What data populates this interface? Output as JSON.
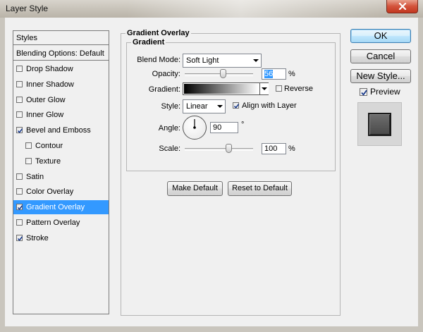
{
  "window": {
    "title": "Layer Style"
  },
  "styles_panel": {
    "header": "Styles",
    "blending_options": "Blending Options: Default",
    "items": [
      {
        "label": "Drop Shadow",
        "checked": false,
        "indent": false,
        "selected": false
      },
      {
        "label": "Inner Shadow",
        "checked": false,
        "indent": false,
        "selected": false
      },
      {
        "label": "Outer Glow",
        "checked": false,
        "indent": false,
        "selected": false
      },
      {
        "label": "Inner Glow",
        "checked": false,
        "indent": false,
        "selected": false
      },
      {
        "label": "Bevel and Emboss",
        "checked": true,
        "indent": false,
        "selected": false
      },
      {
        "label": "Contour",
        "checked": false,
        "indent": true,
        "selected": false
      },
      {
        "label": "Texture",
        "checked": false,
        "indent": true,
        "selected": false
      },
      {
        "label": "Satin",
        "checked": false,
        "indent": false,
        "selected": false
      },
      {
        "label": "Color Overlay",
        "checked": false,
        "indent": false,
        "selected": false
      },
      {
        "label": "Gradient Overlay",
        "checked": true,
        "indent": false,
        "selected": true
      },
      {
        "label": "Pattern Overlay",
        "checked": false,
        "indent": false,
        "selected": false
      },
      {
        "label": "Stroke",
        "checked": true,
        "indent": false,
        "selected": false
      }
    ]
  },
  "gradient_overlay": {
    "group_title": "Gradient Overlay",
    "subgroup_title": "Gradient",
    "blend_mode_label": "Blend Mode:",
    "blend_mode_value": "Soft Light",
    "opacity_label": "Opacity:",
    "opacity_value": "56",
    "opacity_unit": "%",
    "opacity_level": 56,
    "gradient_label": "Gradient:",
    "gradient_colors": [
      "#000000",
      "#ffffff"
    ],
    "reverse_label": "Reverse",
    "reverse_checked": false,
    "style_label": "Style:",
    "style_value": "Linear",
    "align_label": "Align with Layer",
    "align_checked": true,
    "angle_label": "Angle:",
    "angle_value": "90",
    "angle_unit": "°",
    "scale_label": "Scale:",
    "scale_value": "100",
    "scale_unit": "%",
    "scale_level": 100,
    "make_default_label": "Make Default",
    "reset_default_label": "Reset to Default"
  },
  "actions": {
    "ok_label": "OK",
    "cancel_label": "Cancel",
    "new_style_label": "New Style...",
    "preview_label": "Preview",
    "preview_checked": true
  },
  "colors": {
    "selection": "#3399ff",
    "dialog_bg": "#f0f0f0",
    "frame": "#c9c5bd",
    "close_button": "#c8432a"
  },
  "icons": {
    "close": "close-icon",
    "check": "check-icon",
    "dropdown": "chevron-down-icon"
  }
}
